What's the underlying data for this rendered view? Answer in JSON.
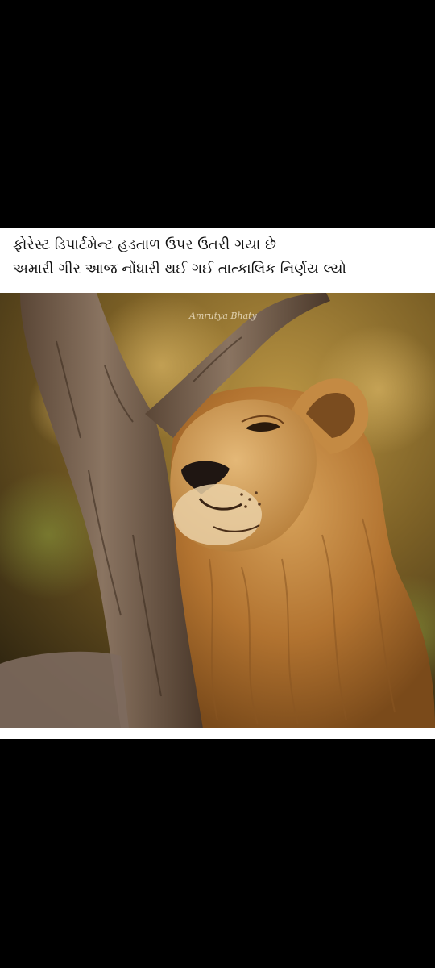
{
  "post": {
    "caption_lines": [
      "ફોરેસ્ટ ડિપાર્ટમેન્ટ હડતાળ ઉપર ઉતરી ગયા છે",
      "અમારી ગીર આજ નોંધારી થઈ ગઈ તાત્કાલિક નિર્ણય લ્યો"
    ],
    "image": {
      "subject": "lion-leaning-on-tree",
      "watermark": "Amrutya Bhaty"
    }
  },
  "colors": {
    "background": "#000000",
    "card": "#ffffff",
    "text": "#111111",
    "bokeh_dark": "#3a2a10",
    "bokeh_warm": "#b48a3a",
    "mane": "#b57a2c",
    "bark": "#6b5643"
  }
}
